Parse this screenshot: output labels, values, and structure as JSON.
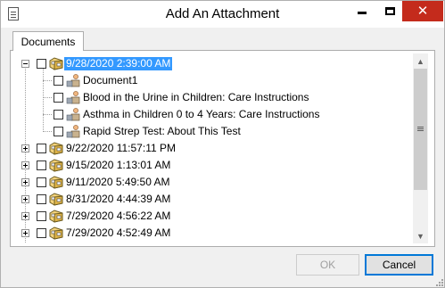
{
  "window": {
    "title": "Add An Attachment",
    "icons": {
      "app": "document-icon",
      "minimize": "minimize-icon",
      "maximize": "maximize-icon",
      "close": "close-icon"
    },
    "close_glyph": "✕"
  },
  "tabs": [
    {
      "label": "Documents",
      "selected": true
    }
  ],
  "tree": {
    "nodes": [
      {
        "label": "9/28/2020 2:39:00 AM",
        "expanded": true,
        "selected": true,
        "checked": false,
        "icon": "folder-icon",
        "children": [
          {
            "label": "Document1",
            "checked": false,
            "icon": "document-person-icon"
          },
          {
            "label": "Blood in the Urine in Children: Care Instructions",
            "checked": false,
            "icon": "document-person-icon"
          },
          {
            "label": "Asthma in Children 0 to 4 Years: Care Instructions",
            "checked": false,
            "icon": "document-person-icon"
          },
          {
            "label": "Rapid Strep Test: About This Test",
            "checked": false,
            "icon": "document-person-icon"
          }
        ]
      },
      {
        "label": "9/22/2020 11:57:11 PM",
        "expanded": false,
        "checked": false,
        "icon": "folder-icon"
      },
      {
        "label": "9/15/2020 1:13:01 AM",
        "expanded": false,
        "checked": false,
        "icon": "folder-icon"
      },
      {
        "label": "9/11/2020 5:49:50 AM",
        "expanded": false,
        "checked": false,
        "icon": "folder-icon"
      },
      {
        "label": "8/31/2020 4:44:39 AM",
        "expanded": false,
        "checked": false,
        "icon": "folder-icon"
      },
      {
        "label": "7/29/2020 4:56:22 AM",
        "expanded": false,
        "checked": false,
        "icon": "folder-icon"
      },
      {
        "label": "7/29/2020 4:52:49 AM",
        "expanded": false,
        "checked": false,
        "icon": "folder-icon"
      }
    ]
  },
  "scrollbar": {
    "up_glyph": "▲",
    "down_glyph": "▼"
  },
  "buttons": {
    "ok": {
      "label": "OK",
      "enabled": false
    },
    "cancel": {
      "label": "Cancel",
      "enabled": true
    }
  },
  "colors": {
    "selection": "#3399ff",
    "close_hover": "#c42b1c",
    "default_button_border": "#0078d7"
  }
}
